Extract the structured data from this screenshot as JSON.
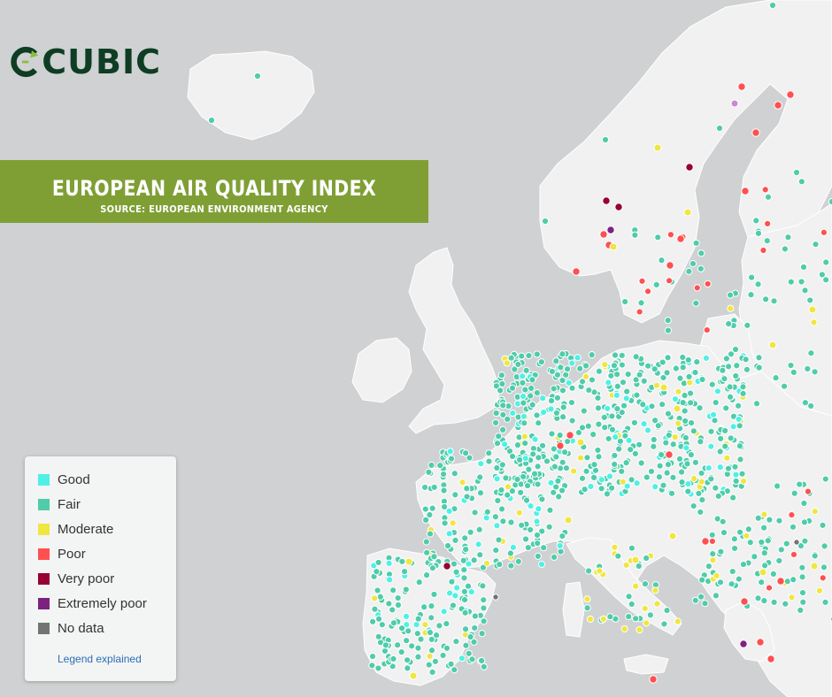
{
  "brand": {
    "name": "CUBIC",
    "color": "#0f3d24",
    "accent": "#8bbf3a"
  },
  "banner": {
    "title": "EUROPEAN AIR QUALITY INDEX",
    "subtitle": "SOURCE: EUROPEAN ENVIRONMENT AGENCY",
    "background": "#7f9f35"
  },
  "legend": {
    "items": [
      {
        "label": "Good",
        "color": "#50f0e6"
      },
      {
        "label": "Fair",
        "color": "#50ccaa"
      },
      {
        "label": "Moderate",
        "color": "#f0e641"
      },
      {
        "label": "Poor",
        "color": "#ff5050"
      },
      {
        "label": "Very poor",
        "color": "#960032"
      },
      {
        "label": "Extremely poor",
        "color": "#7d2181"
      },
      {
        "label": "No data",
        "color": "#737373"
      }
    ],
    "link_label": "Legend explained"
  },
  "map": {
    "sea_color": "#cfd1d2",
    "land_color": "#f1f1f1"
  }
}
